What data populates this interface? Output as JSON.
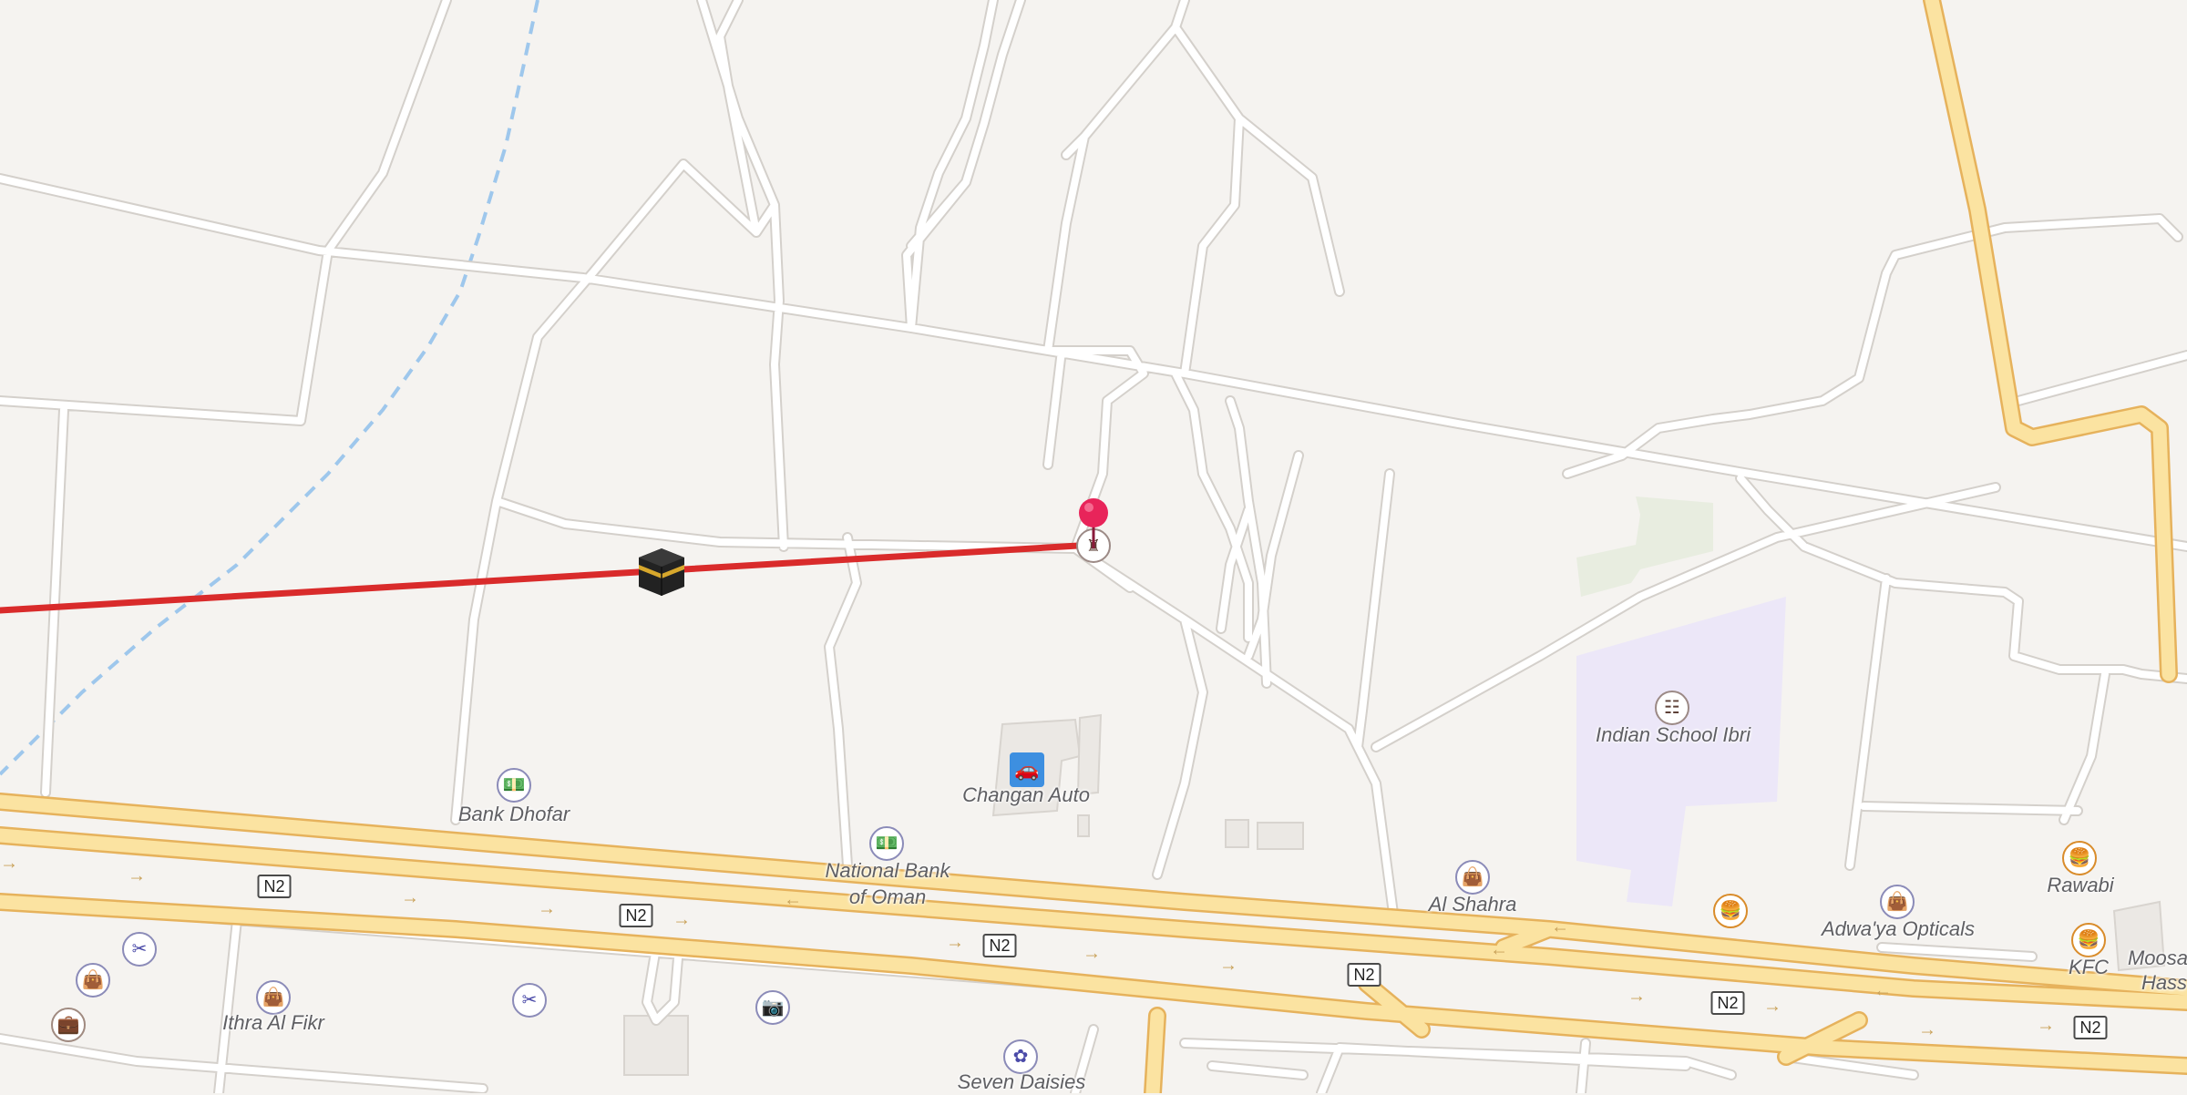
{
  "map": {
    "road_shield": "N2",
    "route_color": "#d92b2b",
    "water_color": "#9ec7ec",
    "highway_color": "#fbe3a1",
    "school_area_color": "#ece7f8",
    "park_area_color": "#e8ede0"
  },
  "labels": {
    "bank_dhofar": "Bank Dhofar",
    "national_bank": "National Bank",
    "national_bank_2": "of Oman",
    "changan": "Changan Auto",
    "indian_school": "Indian School Ibri",
    "al_shahra": "Al Shahra",
    "adwaya": "Adwa'ya Opticals",
    "rawabi": "Rawabi",
    "kfc": "KFC",
    "moosa": "Moosa",
    "moosa_2": "Hass",
    "ithra": "Ithra Al Fikr",
    "seven_daisies": "Seven Daisies"
  },
  "icons": {
    "bank": "banknote-icon",
    "car": "car-icon",
    "school": "school-icon",
    "shop": "shopping-bag-icon",
    "food": "burger-icon",
    "hair": "scissors-icon",
    "photo": "camera-icon",
    "florist": "flower-icon",
    "luggage": "luggage-icon",
    "pin": "map-pin-icon",
    "kaaba": "kaaba-icon",
    "attraction": "monument-icon"
  }
}
